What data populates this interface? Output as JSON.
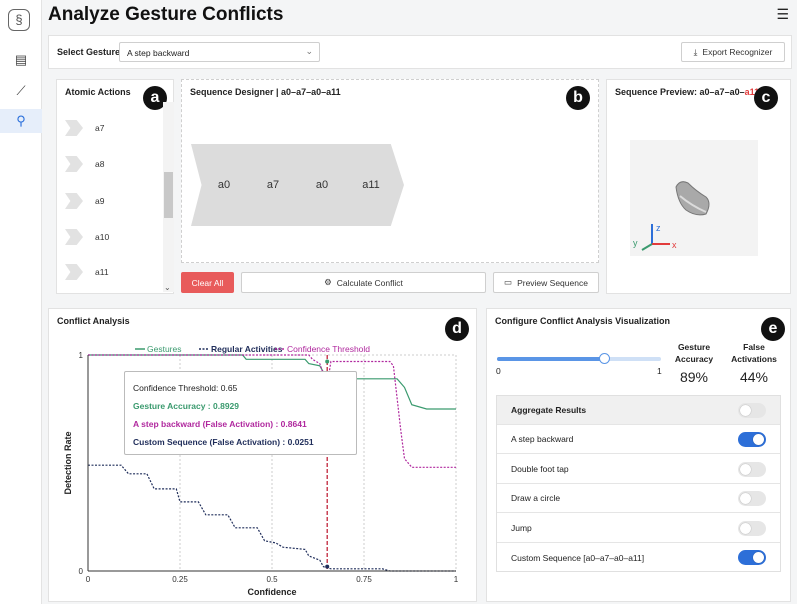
{
  "app": {
    "title": "Analyze Gesture Conflicts"
  },
  "sidebar": {
    "items": [
      {
        "icon": "list-icon",
        "glyph": "▤"
      },
      {
        "icon": "trend-icon",
        "glyph": "⟋"
      },
      {
        "icon": "search-icon",
        "glyph": "⚲"
      }
    ]
  },
  "toolbar": {
    "select_label": "Select Gesture",
    "selected_gesture": "A step backward",
    "export_label": "Export Recognizer"
  },
  "atomic_actions": {
    "title": "Atomic Actions",
    "badge": "a",
    "items": [
      "a7",
      "a8",
      "a9",
      "a10",
      "a11"
    ]
  },
  "designer": {
    "title": "Sequence Designer | a0–a7–a0–a11",
    "badge": "b",
    "sequence": [
      "a0",
      "a7",
      "a0",
      "a11"
    ],
    "clear_label": "Clear All",
    "calculate_label": "Calculate Conflict",
    "preview_label": "Preview Sequence"
  },
  "preview": {
    "title_prefix": "Sequence Preview: a0–a7–a0–",
    "title_highlight": "a11",
    "badge": "c",
    "axes": {
      "x": "x",
      "y": "y",
      "z": "z"
    }
  },
  "conflict_analysis": {
    "title": "Conflict Analysis",
    "badge": "d",
    "tooltip": {
      "threshold": "Confidence Threshold: 0.65",
      "accuracy": "Gesture Accuracy : 0.8929",
      "false_a": "A step backward (False Activation) : 0.8641",
      "false_b": "Custom Sequence (False Activation) : 0.0251"
    }
  },
  "chart_data": {
    "type": "line",
    "xlabel": "Confidence",
    "ylabel": "Detection Rate",
    "xlim": [
      0,
      1
    ],
    "ylim": [
      0,
      1
    ],
    "xticks": [
      "0",
      "0.25",
      "0.5",
      "0.75",
      "1"
    ],
    "yticks": [
      "0",
      "1"
    ],
    "legend": "top",
    "threshold": 0.65,
    "series": [
      {
        "name": "Gestures",
        "color": "#3a9a6e",
        "style": "solid",
        "points": [
          [
            0,
            1
          ],
          [
            0.42,
            1
          ],
          [
            0.43,
            0.98
          ],
          [
            0.59,
            0.98
          ],
          [
            0.6,
            0.96
          ],
          [
            0.63,
            0.95
          ],
          [
            0.65,
            0.89
          ],
          [
            0.66,
            0.89
          ],
          [
            0.67,
            0.89
          ],
          [
            0.84,
            0.89
          ],
          [
            0.86,
            0.85
          ],
          [
            0.88,
            0.77
          ],
          [
            0.92,
            0.75
          ],
          [
            1,
            0.75
          ]
        ]
      },
      {
        "name": "Regular Activities",
        "color": "#1f2d5a",
        "style": "dashed",
        "points": [
          [
            0,
            0.49
          ],
          [
            0.09,
            0.49
          ],
          [
            0.11,
            0.45
          ],
          [
            0.16,
            0.45
          ],
          [
            0.18,
            0.38
          ],
          [
            0.24,
            0.38
          ],
          [
            0.25,
            0.32
          ],
          [
            0.3,
            0.32
          ],
          [
            0.32,
            0.26
          ],
          [
            0.38,
            0.26
          ],
          [
            0.4,
            0.2
          ],
          [
            0.46,
            0.2
          ],
          [
            0.48,
            0.14
          ],
          [
            0.51,
            0.13
          ],
          [
            0.53,
            0.11
          ],
          [
            0.59,
            0.1
          ],
          [
            0.6,
            0.07
          ],
          [
            0.63,
            0.05
          ],
          [
            0.64,
            0.02
          ],
          [
            0.66,
            0.01
          ],
          [
            0.8,
            0.01
          ],
          [
            0.82,
            0
          ],
          [
            1,
            0
          ]
        ]
      },
      {
        "name": "Confidence Threshold",
        "color": "#b0289e",
        "style": "dashed",
        "points": [
          [
            0,
            1
          ],
          [
            0.6,
            1
          ],
          [
            0.61,
            0.98
          ],
          [
            0.63,
            0.96
          ],
          [
            0.65,
            0.86
          ],
          [
            0.66,
            0.97
          ],
          [
            0.82,
            0.97
          ],
          [
            0.83,
            0.95
          ],
          [
            0.84,
            0.8
          ],
          [
            0.85,
            0.65
          ],
          [
            0.86,
            0.52
          ],
          [
            0.88,
            0.48
          ],
          [
            1,
            0.48
          ]
        ]
      }
    ]
  },
  "viz_config": {
    "title": "Configure Conflict Analysis Visualization",
    "badge": "e",
    "slider_min": "0",
    "slider_max": "1",
    "slider_value": 0.65,
    "stats": [
      {
        "label": "Gesture Accuracy",
        "value": "89%"
      },
      {
        "label": "False Activations",
        "value": "44%"
      }
    ],
    "rows": [
      {
        "label": "Aggregate Results",
        "on": false,
        "header": true
      },
      {
        "label": "A step backward",
        "on": true
      },
      {
        "label": "Double foot tap",
        "on": false
      },
      {
        "label": "Draw a circle",
        "on": false
      },
      {
        "label": "Jump",
        "on": false
      },
      {
        "label": "Custom Sequence [a0–a7–a0–a11]",
        "on": true
      }
    ]
  },
  "colors": {
    "accent": "#2d6fd8",
    "danger": "#e85b5b",
    "gestures": "#3a9a6e",
    "threshold": "#b0289e",
    "regular": "#1f2d5a"
  }
}
